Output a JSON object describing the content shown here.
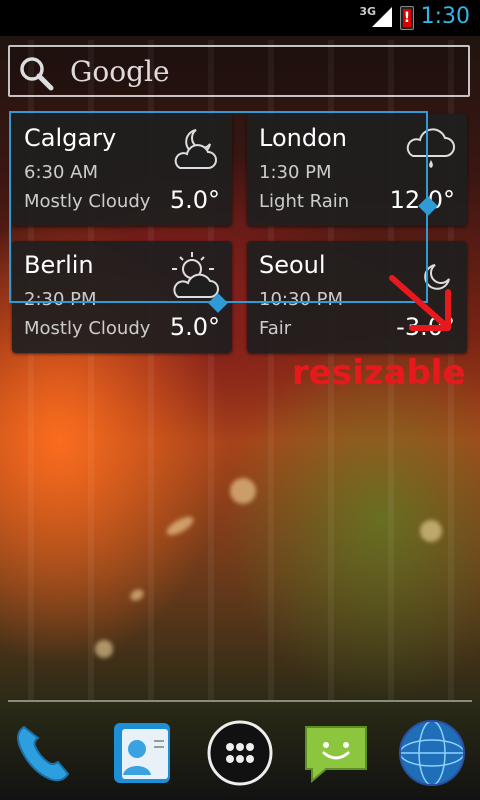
{
  "status_bar": {
    "network": "3G",
    "time": "1:30"
  },
  "search": {
    "label": "Google"
  },
  "widgets": [
    {
      "city": "Calgary",
      "time": "6:30 AM",
      "condition": "Mostly Cloudy",
      "temp": "5.0°",
      "icon": "cloudy-moon-icon"
    },
    {
      "city": "London",
      "time": "1:30 PM",
      "condition": "Light Rain",
      "temp": "12.0°",
      "icon": "rain-cloud-icon"
    },
    {
      "city": "Berlin",
      "time": "2:30 PM",
      "condition": "Mostly Cloudy",
      "temp": "5.0°",
      "icon": "partly-cloudy-sun-icon"
    },
    {
      "city": "Seoul",
      "time": "10:30 PM",
      "condition": "Fair",
      "temp": "-3.0°",
      "icon": "moon-icon"
    }
  ],
  "annotation": {
    "text": "resizable",
    "color": "#e8191c"
  },
  "accent_color": "#33b5e5",
  "resize_frame_color": "#2f9ad3",
  "dock": [
    {
      "icon": "phone-icon"
    },
    {
      "icon": "contacts-icon"
    },
    {
      "icon": "app-drawer-icon"
    },
    {
      "icon": "messaging-icon"
    },
    {
      "icon": "browser-globe-icon"
    }
  ]
}
